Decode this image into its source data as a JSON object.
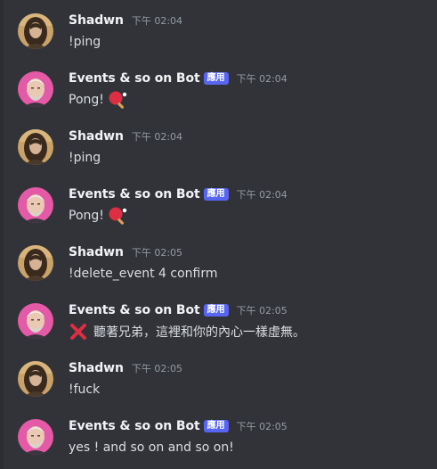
{
  "colors": {
    "background": "#313338",
    "author": "#f2f3f5",
    "text": "#dbdee1",
    "timestamp": "#949ba4",
    "app_tag": "#5865f2"
  },
  "messages": [
    {
      "author": "Shadwn",
      "tag": null,
      "timestamp": "下午 02:04",
      "text": "!ping",
      "emoji": null,
      "avatar": "portrait-woman-avatar"
    },
    {
      "author": "Events & so on Bot",
      "tag": "應用",
      "timestamp": "下午 02:04",
      "text": "Pong!",
      "emoji": "ping-pong-icon",
      "avatar": "portrait-man-pink-avatar"
    },
    {
      "author": "Shadwn",
      "tag": null,
      "timestamp": "下午 02:04",
      "text": "!ping",
      "emoji": null,
      "avatar": "portrait-woman-avatar"
    },
    {
      "author": "Events & so on Bot",
      "tag": "應用",
      "timestamp": "下午 02:04",
      "text": "Pong!",
      "emoji": "ping-pong-icon",
      "avatar": "portrait-man-pink-avatar"
    },
    {
      "author": "Shadwn",
      "tag": null,
      "timestamp": "下午 02:05",
      "text": "!delete_event 4 confirm",
      "emoji": null,
      "avatar": "portrait-woman-avatar"
    },
    {
      "author": "Events & so on Bot",
      "tag": "應用",
      "timestamp": "下午 02:05",
      "text": "聽著兄弟，這裡和你的內心一樣虛無。",
      "emoji": "red-x-icon",
      "avatar": "portrait-man-pink-avatar"
    },
    {
      "author": "Shadwn",
      "tag": null,
      "timestamp": "下午 02:05",
      "text": "!fuck",
      "emoji": null,
      "avatar": "portrait-woman-avatar"
    },
    {
      "author": "Events & so on Bot",
      "tag": "應用",
      "timestamp": "下午 02:05",
      "text": "yes ! and so on and so on!",
      "emoji": null,
      "avatar": "portrait-man-pink-avatar"
    }
  ]
}
